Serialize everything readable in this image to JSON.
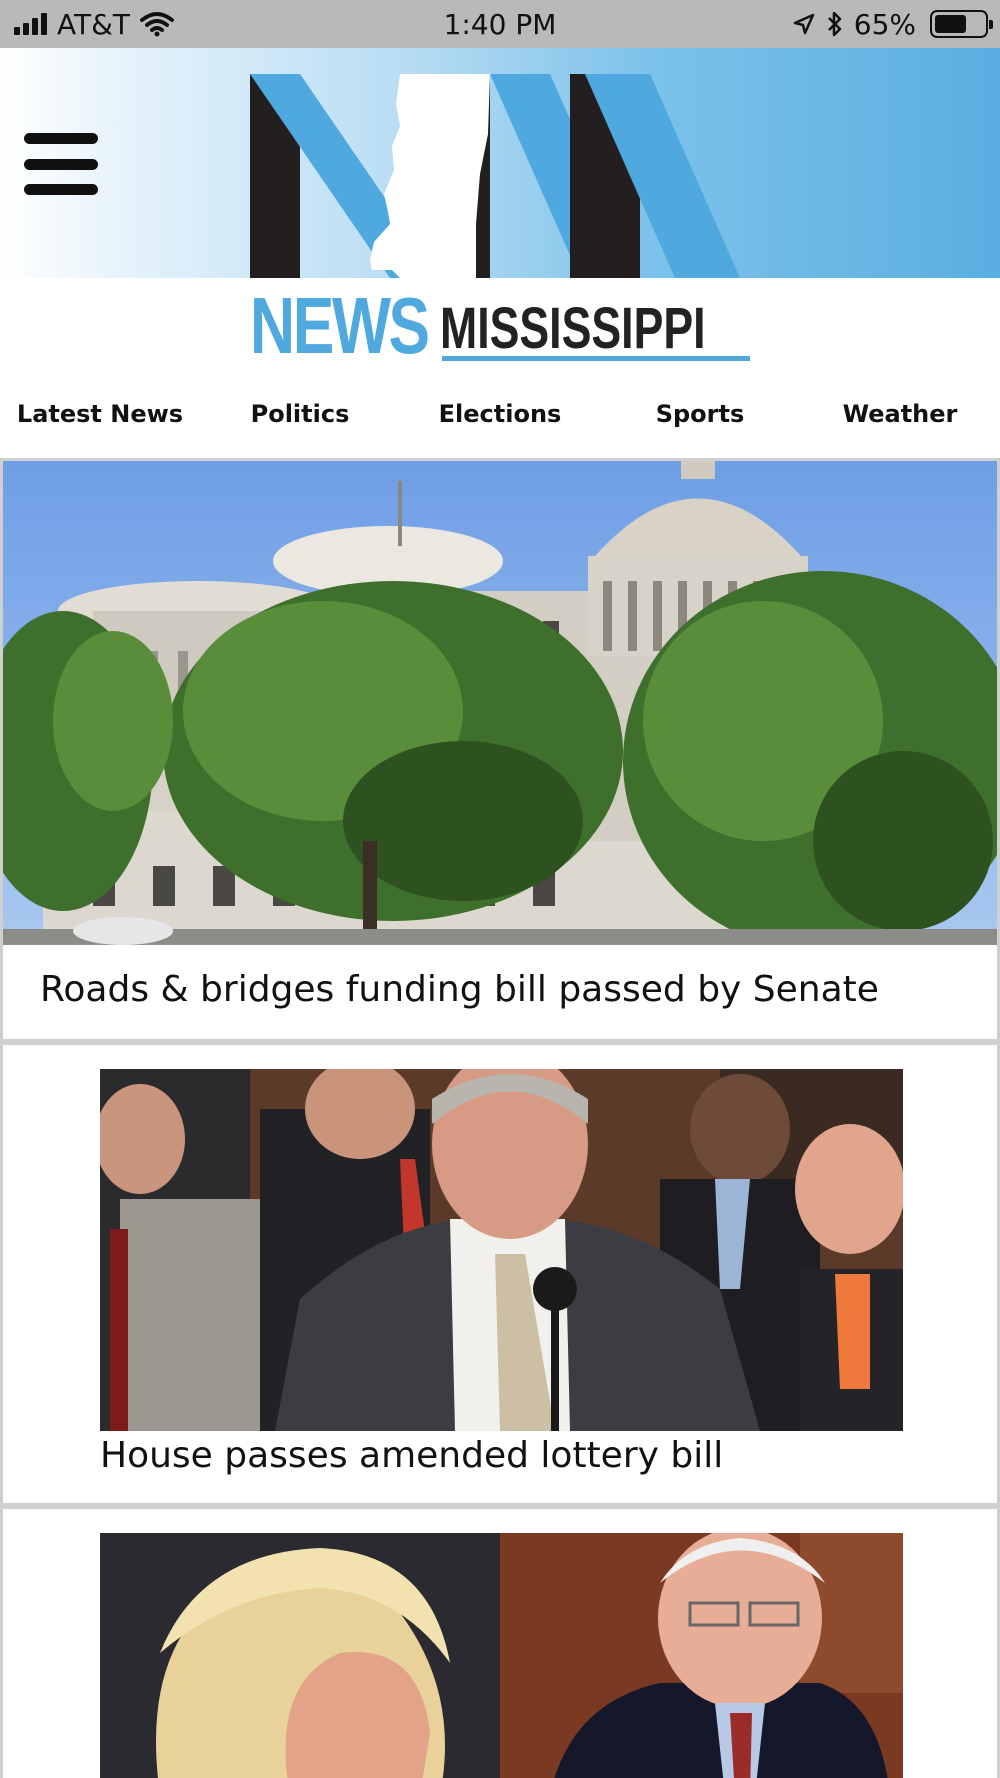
{
  "status_bar": {
    "carrier": "AT&T",
    "time": "1:40 PM",
    "battery": "65%",
    "battery_level": 0.65,
    "icons": [
      "signal-icon",
      "wifi-icon",
      "location-icon",
      "bluetooth-icon",
      "battery-icon"
    ]
  },
  "header": {
    "menu_icon": "hamburger-menu-icon",
    "brand_news": "NEWS",
    "brand_mississippi": "MISSISSIPPI",
    "colors": {
      "brand_blue": "#4fa9de",
      "dark": "#231f20"
    }
  },
  "nav": {
    "items": [
      {
        "label": "Latest News"
      },
      {
        "label": "Politics"
      },
      {
        "label": "Elections"
      },
      {
        "label": "Sports"
      },
      {
        "label": "Weather"
      }
    ]
  },
  "stories": [
    {
      "headline": "Roads & bridges funding bill passed by Senate"
    },
    {
      "headline": "House passes amended lottery bill"
    },
    {
      "headline": ""
    }
  ]
}
